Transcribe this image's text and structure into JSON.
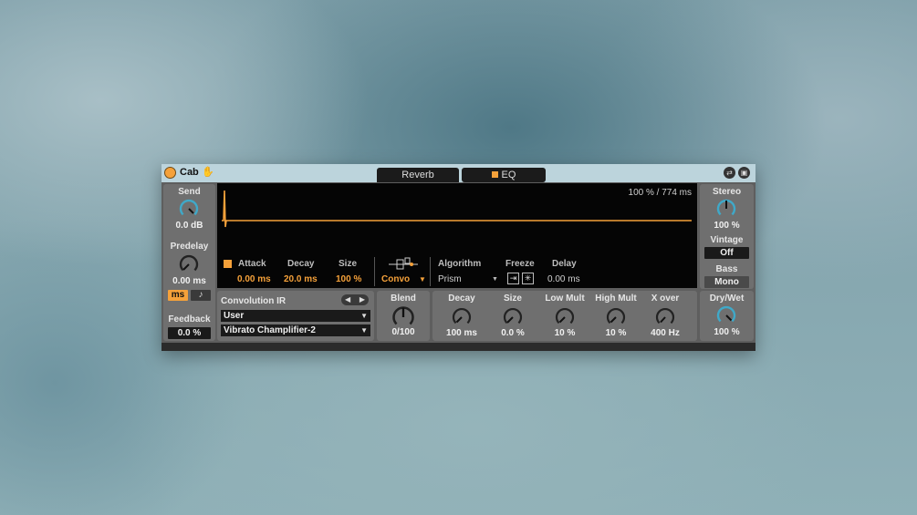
{
  "device": {
    "name": "Cab",
    "tabs": [
      {
        "label": "Reverb"
      },
      {
        "label": "EQ"
      }
    ]
  },
  "left": {
    "send_label": "Send",
    "send_value": "0.0 dB",
    "predelay_label": "Predelay",
    "predelay_value": "0.00 ms",
    "ms_label": "ms",
    "note_label": "♪",
    "feedback_label": "Feedback",
    "feedback_value": "0.0 %"
  },
  "display": {
    "readout": "100 % / 774 ms",
    "attack_label": "Attack",
    "attack_value": "0.00 ms",
    "decay_label": "Decay",
    "decay_value": "20.0 ms",
    "size_label": "Size",
    "size_value": "100 %",
    "mode_value": "Convo",
    "algorithm_label": "Algorithm",
    "algorithm_value": "Prism",
    "freeze_label": "Freeze",
    "delay_label": "Delay",
    "delay_value": "0.00 ms"
  },
  "convolution": {
    "title": "Convolution IR",
    "category": "User",
    "ir_file": "Vibrato Champlifier-2"
  },
  "blend": {
    "label": "Blend",
    "value": "0/100"
  },
  "knobs": [
    {
      "label": "Decay",
      "value": "100 ms"
    },
    {
      "label": "Size",
      "value": "0.0 %"
    },
    {
      "label": "Low Mult",
      "value": "10 %"
    },
    {
      "label": "High Mult",
      "value": "10 %"
    },
    {
      "label": "X over",
      "value": "400 Hz"
    }
  ],
  "right": {
    "stereo_label": "Stereo",
    "stereo_value": "100 %",
    "vintage_label": "Vintage",
    "vintage_value": "Off",
    "bass_label": "Bass",
    "bass_value": "Mono",
    "drywet_label": "Dry/Wet",
    "drywet_value": "100 %"
  },
  "colors": {
    "accent": "#f5a13a",
    "knob_arc": "#3fa9c9",
    "title_bar": "#bcd4dc"
  },
  "icons": [
    "power-icon",
    "hand-icon",
    "swap-icon",
    "save-icon",
    "routing-icon",
    "freeze-in-icon",
    "freeze-icon",
    "prev-icon",
    "next-icon"
  ]
}
